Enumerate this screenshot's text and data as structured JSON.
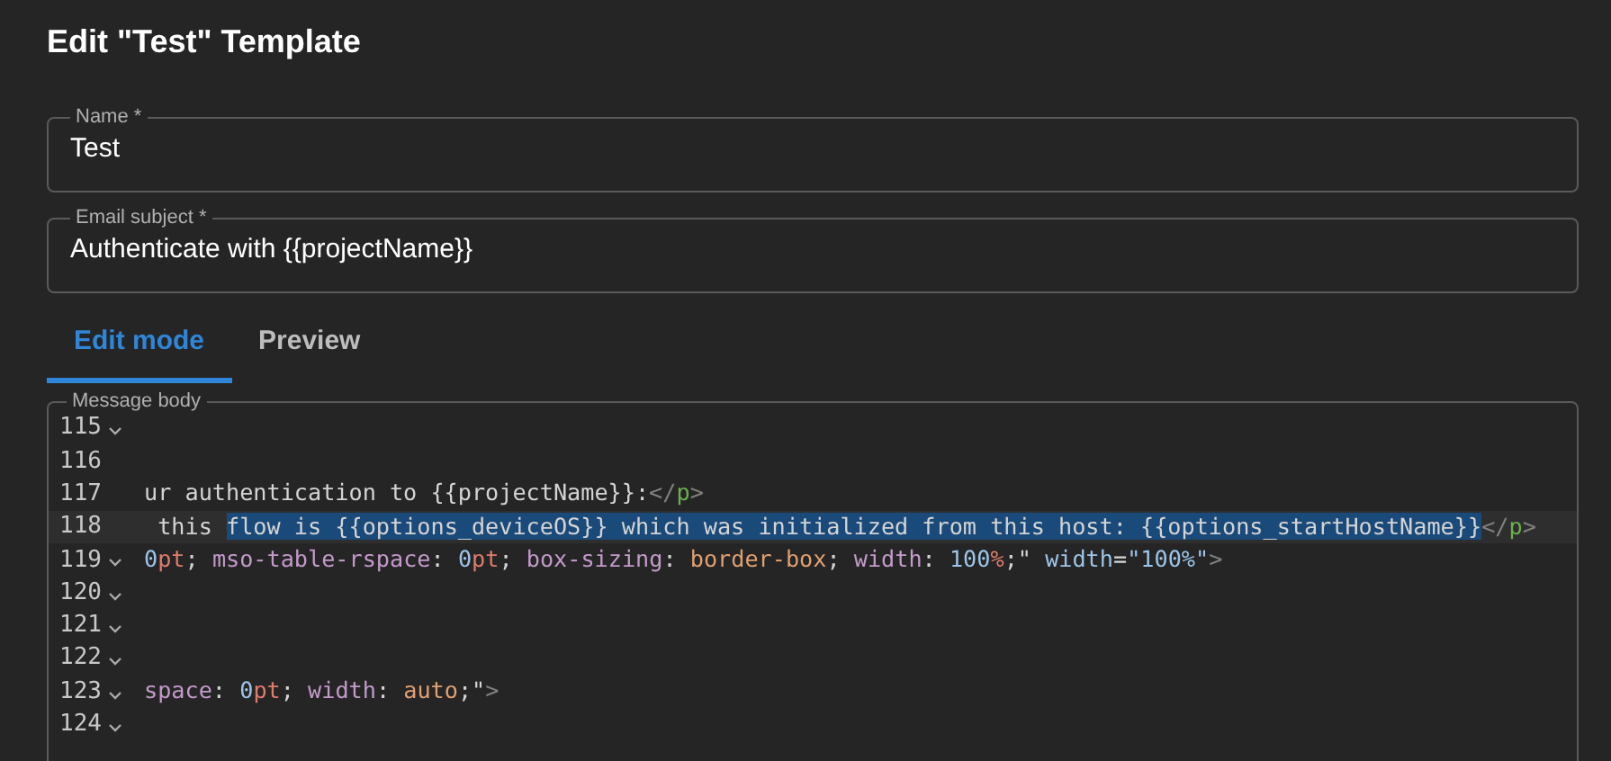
{
  "title": "Edit \"Test\" Template",
  "fields": [
    {
      "label": "Name *",
      "value": "Test"
    },
    {
      "label": "Email subject *",
      "value": "Authenticate with {{projectName}}"
    }
  ],
  "tabs": [
    {
      "label": "Edit mode",
      "selected": true
    },
    {
      "label": "Preview",
      "selected": false
    }
  ],
  "editor": {
    "label": "Message body",
    "lines": [
      {
        "number": "115",
        "foldable": true,
        "current": false
      },
      {
        "number": "116",
        "foldable": false,
        "current": false
      },
      {
        "number": "117",
        "foldable": false,
        "current": false,
        "tokens": [
          {
            "kind": "text",
            "text": "ur authentication to {{projectName}}:",
            "selected": false
          },
          {
            "kind": "punct",
            "text": "</",
            "selected": false
          },
          {
            "kind": "tag",
            "text": "p",
            "selected": false
          },
          {
            "kind": "punct",
            "text": ">",
            "selected": false
          }
        ]
      },
      {
        "number": "118",
        "foldable": false,
        "current": true,
        "tokens": [
          {
            "kind": "text",
            "text": " this ",
            "selected": false
          },
          {
            "kind": "text",
            "text": "flow is {{options_deviceOS}} which was initialized from this host: {{options_startHostName}}",
            "selected": true
          },
          {
            "kind": "punct",
            "text": "</",
            "selected": false
          },
          {
            "kind": "tag",
            "text": "p",
            "selected": false
          },
          {
            "kind": "punct",
            "text": ">",
            "selected": false
          }
        ]
      },
      {
        "number": "119",
        "foldable": true,
        "current": false,
        "tokens": [
          {
            "kind": "number",
            "text": "0",
            "selected": false
          },
          {
            "kind": "unit",
            "text": "pt",
            "selected": false
          },
          {
            "kind": "text",
            "text": "; ",
            "selected": false
          },
          {
            "kind": "prop",
            "text": "mso-table-rspace",
            "selected": false
          },
          {
            "kind": "text",
            "text": ": ",
            "selected": false
          },
          {
            "kind": "number",
            "text": "0",
            "selected": false
          },
          {
            "kind": "unit",
            "text": "pt",
            "selected": false
          },
          {
            "kind": "text",
            "text": "; ",
            "selected": false
          },
          {
            "kind": "prop",
            "text": "box-sizing",
            "selected": false
          },
          {
            "kind": "text",
            "text": ": ",
            "selected": false
          },
          {
            "kind": "value",
            "text": "border-box",
            "selected": false
          },
          {
            "kind": "text",
            "text": "; ",
            "selected": false
          },
          {
            "kind": "prop",
            "text": "width",
            "selected": false
          },
          {
            "kind": "text",
            "text": ": ",
            "selected": false
          },
          {
            "kind": "number",
            "text": "100",
            "selected": false
          },
          {
            "kind": "unit",
            "text": "%",
            "selected": false
          },
          {
            "kind": "text",
            "text": ";\" ",
            "selected": false
          },
          {
            "kind": "attr",
            "text": "width",
            "selected": false
          },
          {
            "kind": "text",
            "text": "=",
            "selected": false
          },
          {
            "kind": "attr",
            "text": "\"100%\"",
            "selected": false
          },
          {
            "kind": "punct",
            "text": ">",
            "selected": false
          }
        ]
      },
      {
        "number": "120",
        "foldable": true,
        "current": false
      },
      {
        "number": "121",
        "foldable": true,
        "current": false
      },
      {
        "number": "122",
        "foldable": true,
        "current": false
      },
      {
        "number": "123",
        "foldable": true,
        "current": false,
        "tokens": [
          {
            "kind": "prop",
            "text": "space",
            "selected": false
          },
          {
            "kind": "text",
            "text": ": ",
            "selected": false
          },
          {
            "kind": "number",
            "text": "0",
            "selected": false
          },
          {
            "kind": "unit",
            "text": "pt",
            "selected": false
          },
          {
            "kind": "text",
            "text": "; ",
            "selected": false
          },
          {
            "kind": "prop",
            "text": "width",
            "selected": false
          },
          {
            "kind": "text",
            "text": ": ",
            "selected": false
          },
          {
            "kind": "value",
            "text": "auto",
            "selected": false
          },
          {
            "kind": "text",
            "text": ";\"",
            "selected": false
          },
          {
            "kind": "punct",
            "text": ">",
            "selected": false
          }
        ]
      },
      {
        "number": "124",
        "foldable": true,
        "current": false
      }
    ]
  }
}
